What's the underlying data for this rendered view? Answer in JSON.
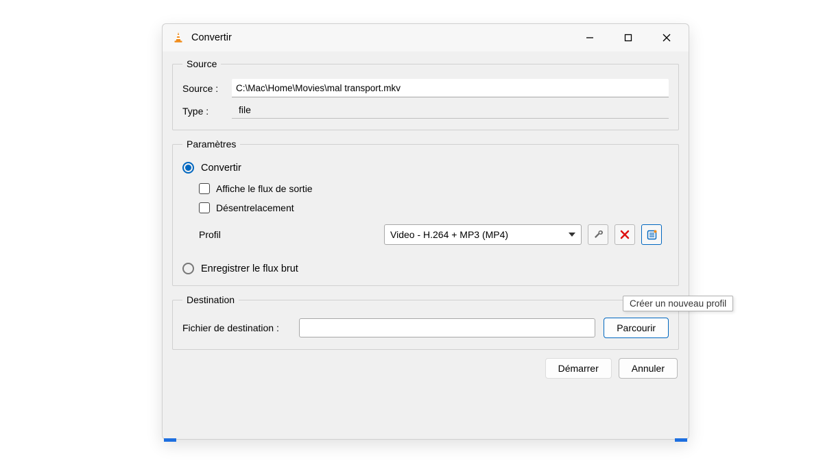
{
  "window": {
    "title": "Convertir"
  },
  "source_group": {
    "legend": "Source",
    "label_source": "Source :",
    "value_source": "C:\\Mac\\Home\\Movies\\mal transport.mkv",
    "label_type": "Type :",
    "value_type": "file"
  },
  "params_group": {
    "legend": "Paramètres",
    "radio_convert": "Convertir",
    "check_display_output": "Affiche le flux de sortie",
    "check_deinterlace": "Désentrelacement",
    "label_profile": "Profil",
    "select_profile": "Video - H.264 + MP3 (MP4)",
    "radio_dump_raw": "Enregistrer le flux brut",
    "tooltip_new_profile": "Créer un nouveau profil"
  },
  "dest_group": {
    "legend": "Destination",
    "label_dest_file": "Fichier de destination :",
    "value_dest_file": "",
    "btn_browse": "Parcourir"
  },
  "footer": {
    "btn_start": "Démarrer",
    "btn_cancel": "Annuler"
  }
}
